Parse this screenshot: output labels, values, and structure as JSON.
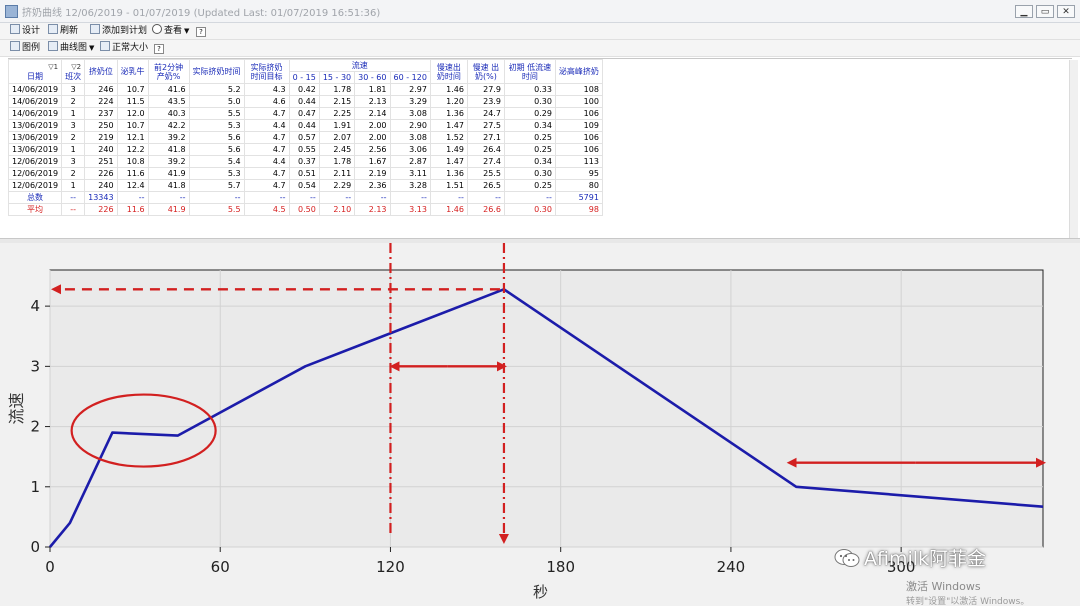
{
  "window": {
    "title": "挤奶曲线 12/06/2019 - 01/07/2019 (Updated Last: 01/07/2019 16:51:36)"
  },
  "toolbar1": {
    "design": "设计",
    "refresh": "刷新",
    "add_to_plan": "添加到计划",
    "view": "查看"
  },
  "toolbar2": {
    "legend": "图例",
    "curve": "曲线图",
    "normal_size": "正常大小"
  },
  "table": {
    "flow_group_header": "流速",
    "sort_marks": [
      "▽1",
      "▽2"
    ],
    "headers": {
      "date": "日期",
      "shift": "班次",
      "stall": "挤奶位",
      "cow": "泌乳牛",
      "first2": "前2分钟 产奶%",
      "actual_time": "实际挤奶时间",
      "actual_target": "实际挤奶 时间目标",
      "f1": "0 - 15",
      "f2": "15 - 30",
      "f3": "30 - 60",
      "f4": "60 - 120",
      "slow_out": "慢速出 奶时间",
      "slow_pct": "慢速 出奶(%)",
      "initial_low": "初期 低流速时间",
      "peak_flow": "泌高峰挤奶"
    },
    "rows": [
      [
        "14/06/2019",
        "3",
        "246",
        "10.7",
        "41.6",
        "5.2",
        "4.3",
        "0.42",
        "1.78",
        "1.81",
        "2.97",
        "1.46",
        "27.9",
        "0.33",
        "108"
      ],
      [
        "14/06/2019",
        "2",
        "224",
        "11.5",
        "43.5",
        "5.0",
        "4.6",
        "0.44",
        "2.15",
        "2.13",
        "3.29",
        "1.20",
        "23.9",
        "0.30",
        "100"
      ],
      [
        "14/06/2019",
        "1",
        "237",
        "12.0",
        "40.3",
        "5.5",
        "4.7",
        "0.47",
        "2.25",
        "2.14",
        "3.08",
        "1.36",
        "24.7",
        "0.29",
        "106"
      ],
      [
        "13/06/2019",
        "3",
        "250",
        "10.7",
        "42.2",
        "5.3",
        "4.4",
        "0.44",
        "1.91",
        "2.00",
        "2.90",
        "1.47",
        "27.5",
        "0.34",
        "109"
      ],
      [
        "13/06/2019",
        "2",
        "219",
        "12.1",
        "39.2",
        "5.6",
        "4.7",
        "0.57",
        "2.07",
        "2.00",
        "3.08",
        "1.52",
        "27.1",
        "0.25",
        "106"
      ],
      [
        "13/06/2019",
        "1",
        "240",
        "12.2",
        "41.8",
        "5.6",
        "4.7",
        "0.55",
        "2.45",
        "2.56",
        "3.06",
        "1.49",
        "26.4",
        "0.25",
        "106"
      ],
      [
        "12/06/2019",
        "3",
        "251",
        "10.8",
        "39.2",
        "5.4",
        "4.4",
        "0.37",
        "1.78",
        "1.67",
        "2.87",
        "1.47",
        "27.4",
        "0.34",
        "113"
      ],
      [
        "12/06/2019",
        "2",
        "226",
        "11.6",
        "41.9",
        "5.3",
        "4.7",
        "0.51",
        "2.11",
        "2.19",
        "3.11",
        "1.36",
        "25.5",
        "0.30",
        "95"
      ],
      [
        "12/06/2019",
        "1",
        "240",
        "12.4",
        "41.8",
        "5.7",
        "4.7",
        "0.54",
        "2.29",
        "2.36",
        "3.28",
        "1.51",
        "26.5",
        "0.25",
        "80"
      ]
    ],
    "total_row": [
      "总数",
      "--",
      "13343",
      "--",
      "--",
      "--",
      "--",
      "--",
      "--",
      "--",
      "--",
      "--",
      "--",
      "--",
      "5791"
    ],
    "avg_row": [
      "平均",
      "--",
      "226",
      "11.6",
      "41.9",
      "5.5",
      "4.5",
      "0.50",
      "2.10",
      "2.13",
      "3.13",
      "1.46",
      "26.6",
      "0.30",
      "98"
    ]
  },
  "chart_data": {
    "type": "line",
    "xlabel": "秒",
    "ylabel": "流速",
    "xlim": [
      0,
      350
    ],
    "ylim": [
      0,
      4.6
    ],
    "xticks": [
      0,
      60,
      120,
      180,
      240,
      300
    ],
    "yticks": [
      0,
      1,
      2,
      3,
      4
    ],
    "series": [
      {
        "x": [
          0,
          7,
          22,
          45,
          90,
          160,
          263,
          350
        ],
        "y": [
          0,
          0.4,
          1.9,
          1.85,
          3.0,
          4.28,
          1.0,
          0.67
        ],
        "color": "#1c1caa"
      }
    ],
    "annotations": {
      "color": "#d22020",
      "circle": {
        "cx": 33,
        "cy": 1.9
      },
      "vertical_lines_x": [
        120,
        160
      ],
      "peak_y": 4.28,
      "span_arrow": {
        "x1": 120,
        "x2": 160,
        "y": 3.0
      },
      "tail_arrow": {
        "x1": 260,
        "x2": 350,
        "y": 1.4
      }
    }
  },
  "watermark": {
    "brand": "Afimilk阿菲金",
    "activate": "激活 Windows",
    "activate_sub": "转到\"设置\"以激活 Windows。"
  }
}
